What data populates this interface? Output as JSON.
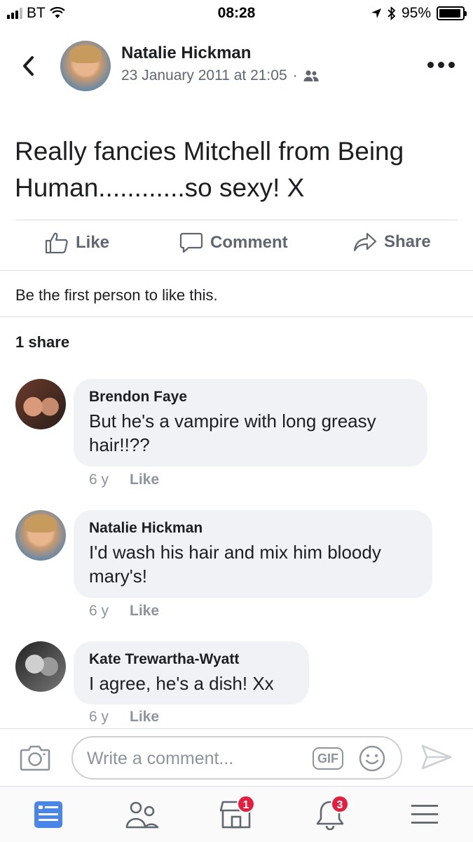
{
  "status_bar": {
    "carrier": "BT",
    "time": "08:28",
    "battery": "95%",
    "battery_level": 0.95
  },
  "post": {
    "author": "Natalie Hickman",
    "date": "23 January 2011 at 21:05",
    "privacy_icon": "friends-icon",
    "text": "Really fancies Mitchell from Being Human............so sexy! X"
  },
  "actions": {
    "like": "Like",
    "comment": "Comment",
    "share": "Share"
  },
  "reactions_text": "Be the first person to like this.",
  "share_count": "1 share",
  "comments": [
    {
      "name": "Brendon Faye",
      "text": "But he's a vampire with long greasy hair!!??",
      "age": "6 y",
      "like": "Like"
    },
    {
      "name": "Natalie Hickman",
      "text": "I'd wash his hair and mix him bloody mary's!",
      "age": "6 y",
      "like": "Like"
    },
    {
      "name": "Kate Trewartha-Wyatt",
      "text": "I agree, he's a dish! Xx",
      "age": "6 y",
      "like": "Like"
    }
  ],
  "composer": {
    "placeholder": "Write a comment...",
    "gif_label": "GIF"
  },
  "tabbar": {
    "marketplace_badge": "1",
    "notifications_badge": "3"
  },
  "colors": {
    "active_tab": "#4a86e8",
    "badge": "#e41e3f",
    "muted": "#606770"
  }
}
